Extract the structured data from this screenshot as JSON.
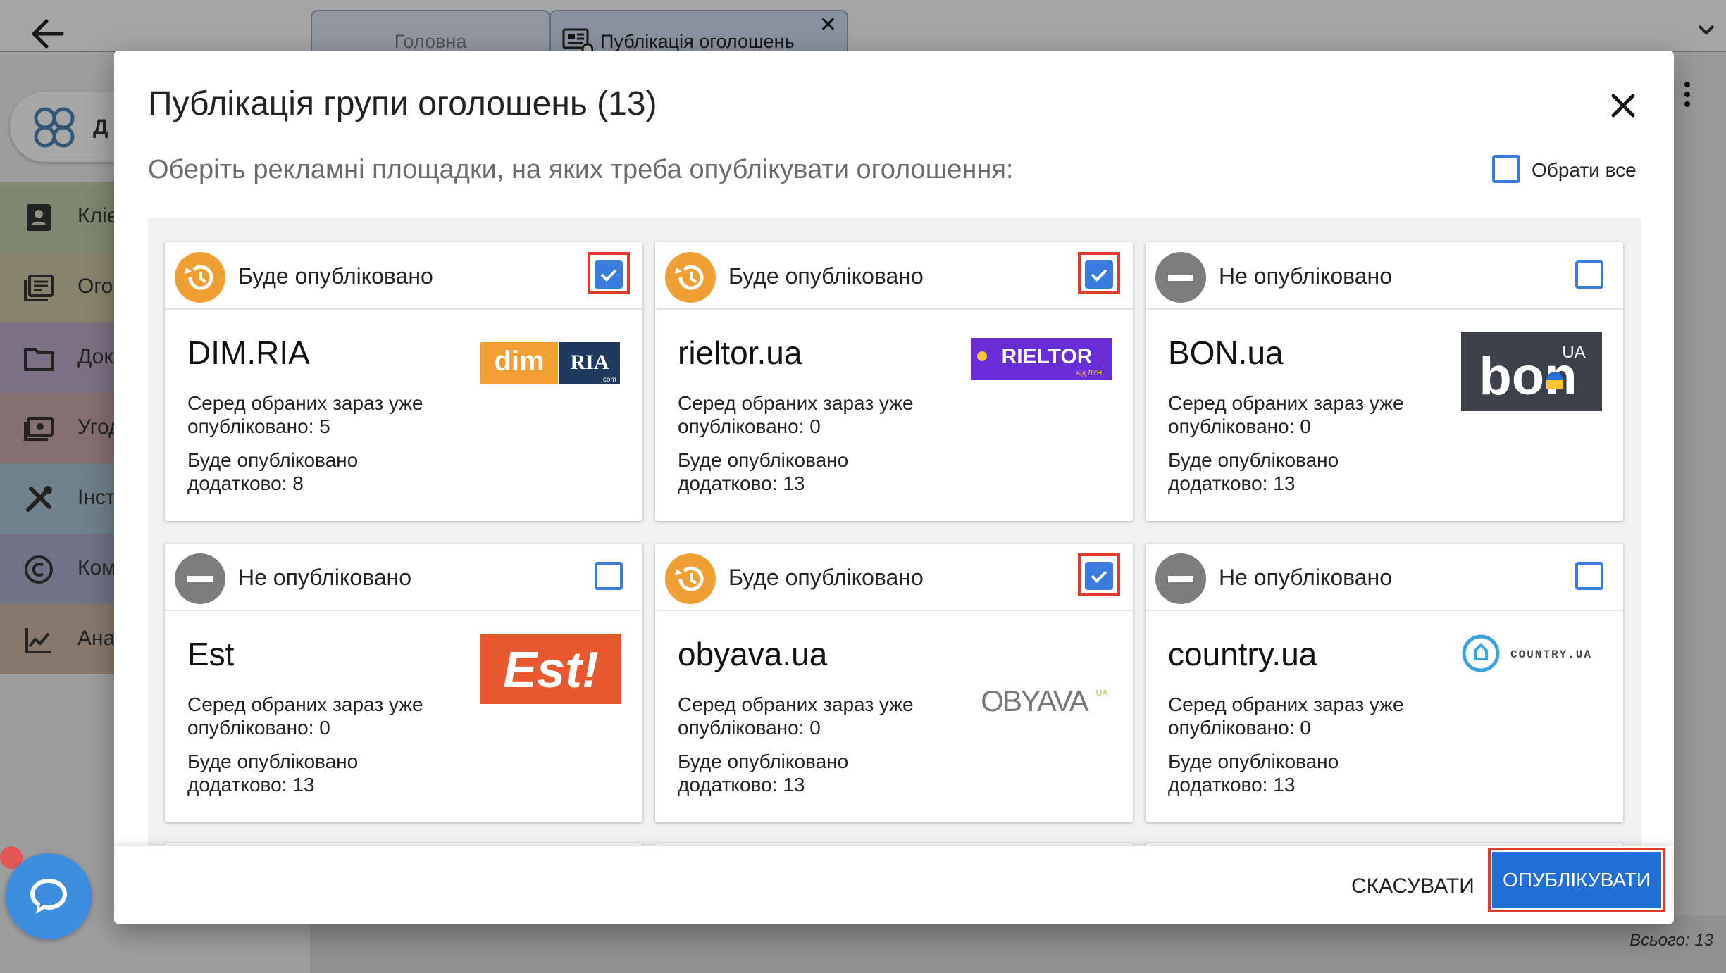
{
  "app": {
    "tabs": [
      {
        "label": "Головна"
      },
      {
        "label": "Публікація оголошень"
      }
    ],
    "sidebar": {
      "logo_text": "Д",
      "items": [
        {
          "label": "Кліє",
          "color": "#b8c9a6",
          "icon": "contacts-icon"
        },
        {
          "label": "Ого.",
          "color": "#c9c39e",
          "icon": "listings-icon"
        },
        {
          "label": "Док",
          "color": "#b7a7c3",
          "icon": "folder-icon"
        },
        {
          "label": "Угод",
          "color": "#c6a4a4",
          "icon": "deals-icon"
        },
        {
          "label": "Інст",
          "color": "#a4bfcf",
          "icon": "tools-icon"
        },
        {
          "label": "Ком",
          "color": "#a6a9c8",
          "icon": "copyright-icon"
        },
        {
          "label": "Ана",
          "color": "#c9b19e",
          "icon": "analytics-icon"
        }
      ]
    },
    "total_text": "Всього: 13"
  },
  "modal": {
    "title": "Публікація групи оголошень (13)",
    "subtitle": "Оберіть рекламні площадки, на яких треба опублікувати оголошення:",
    "select_all_label": "Обрати все",
    "cards": [
      {
        "status": "Будe опубліковано",
        "status_type": "pending",
        "checked": true,
        "name": "DIM.RIA",
        "line1": "Серед обраних зараз уже",
        "line2": "опубліковано: 5",
        "line3": "Буде опубліковано",
        "line4": "додатково: 8",
        "logo_texts": [
          "dim",
          "RIA",
          ".com"
        ]
      },
      {
        "status": "Буде опубліковано",
        "status_type": "pending",
        "checked": true,
        "name": "rieltor.ua",
        "line1": "Серед обраних зараз уже",
        "line2": "опубліковано: 0",
        "line3": "Буде опубліковано",
        "line4": "додатково: 13",
        "logo_texts": [
          "RIELTOR",
          "від ЛУН"
        ]
      },
      {
        "status": "Не опубліковано",
        "status_type": "none",
        "checked": false,
        "name": "BON.ua",
        "line1": "Серед обраних зараз уже",
        "line2": "опубліковано: 0",
        "line3": "Буде опубліковано",
        "line4": "додатково: 13",
        "logo_texts": [
          "bon",
          "UA"
        ]
      },
      {
        "status": "Не опубліковано",
        "status_type": "none",
        "checked": false,
        "name": "Est",
        "line1": "Серед обраних зараз уже",
        "line2": "опубліковано: 0",
        "line3": "Буде опубліковано",
        "line4": "додатково: 13",
        "logo_texts": [
          "Est!"
        ]
      },
      {
        "status": "Буде опубліковано",
        "status_type": "pending",
        "checked": true,
        "name": "obyava.ua",
        "line1": "Серед обраних зараз уже",
        "line2": "опубліковано: 0",
        "line3": "Буде опубліковано",
        "line4": "додатково: 13",
        "logo_texts": [
          "OBYAVA",
          "UA"
        ]
      },
      {
        "status": "Не опубліковано",
        "status_type": "none",
        "checked": false,
        "name": "country.ua",
        "line1": "Серед обраних зараз уже",
        "line2": "опубліковано: 0",
        "line3": "Буде опубліковано",
        "line4": "додатково: 13",
        "logo_texts": [
          "COUNTRY.UA"
        ]
      }
    ],
    "cancel_label": "СКАСУВАТИ",
    "publish_label": "ОПУБЛІКУВАТИ"
  },
  "colors": {
    "accent": "#1f6fd6",
    "checkbox": "#3a7be0",
    "pending": "#f0a033",
    "not_published": "#7c7c7c",
    "highlight": "#e03a2f"
  }
}
